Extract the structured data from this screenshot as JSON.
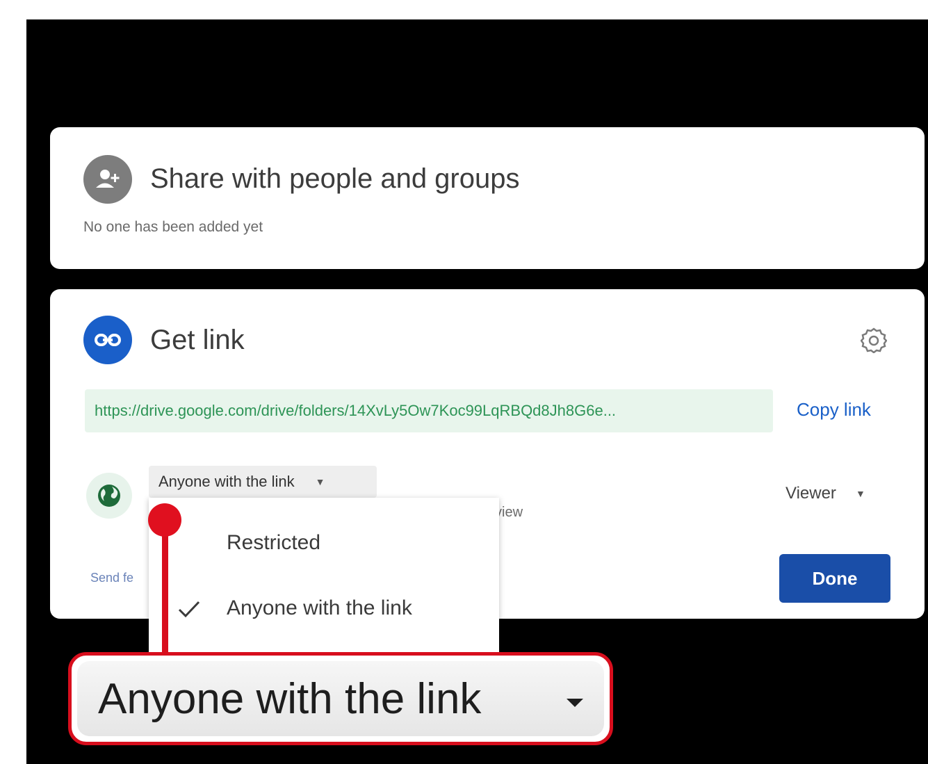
{
  "share_card": {
    "title": "Share with people and groups",
    "subtitle": "No one has been added yet",
    "icon": "person-add-icon"
  },
  "link_card": {
    "title": "Get link",
    "icon": "link-icon",
    "settings_icon": "gear-icon",
    "url": "https://drive.google.com/drive/folders/14XvLy5Ow7Koc99LqRBQd8Jh8G6e...",
    "copy_label": "Copy link",
    "access_value": "Anyone with the link",
    "access_desc_tail": "view",
    "role_value": "Viewer",
    "feedback_text": "Send fe",
    "done_label": "Done"
  },
  "dropdown": {
    "options": [
      {
        "label": "Restricted",
        "selected": false
      },
      {
        "label": "Anyone with the link",
        "selected": true
      }
    ]
  },
  "callout": {
    "label": "Anyone with the link"
  },
  "colors": {
    "accent_blue": "#1a5fc9",
    "done_blue": "#1a4ea8",
    "link_green": "#2d9456",
    "link_bg": "#e8f5ec",
    "highlight_red": "#d80e1d"
  }
}
